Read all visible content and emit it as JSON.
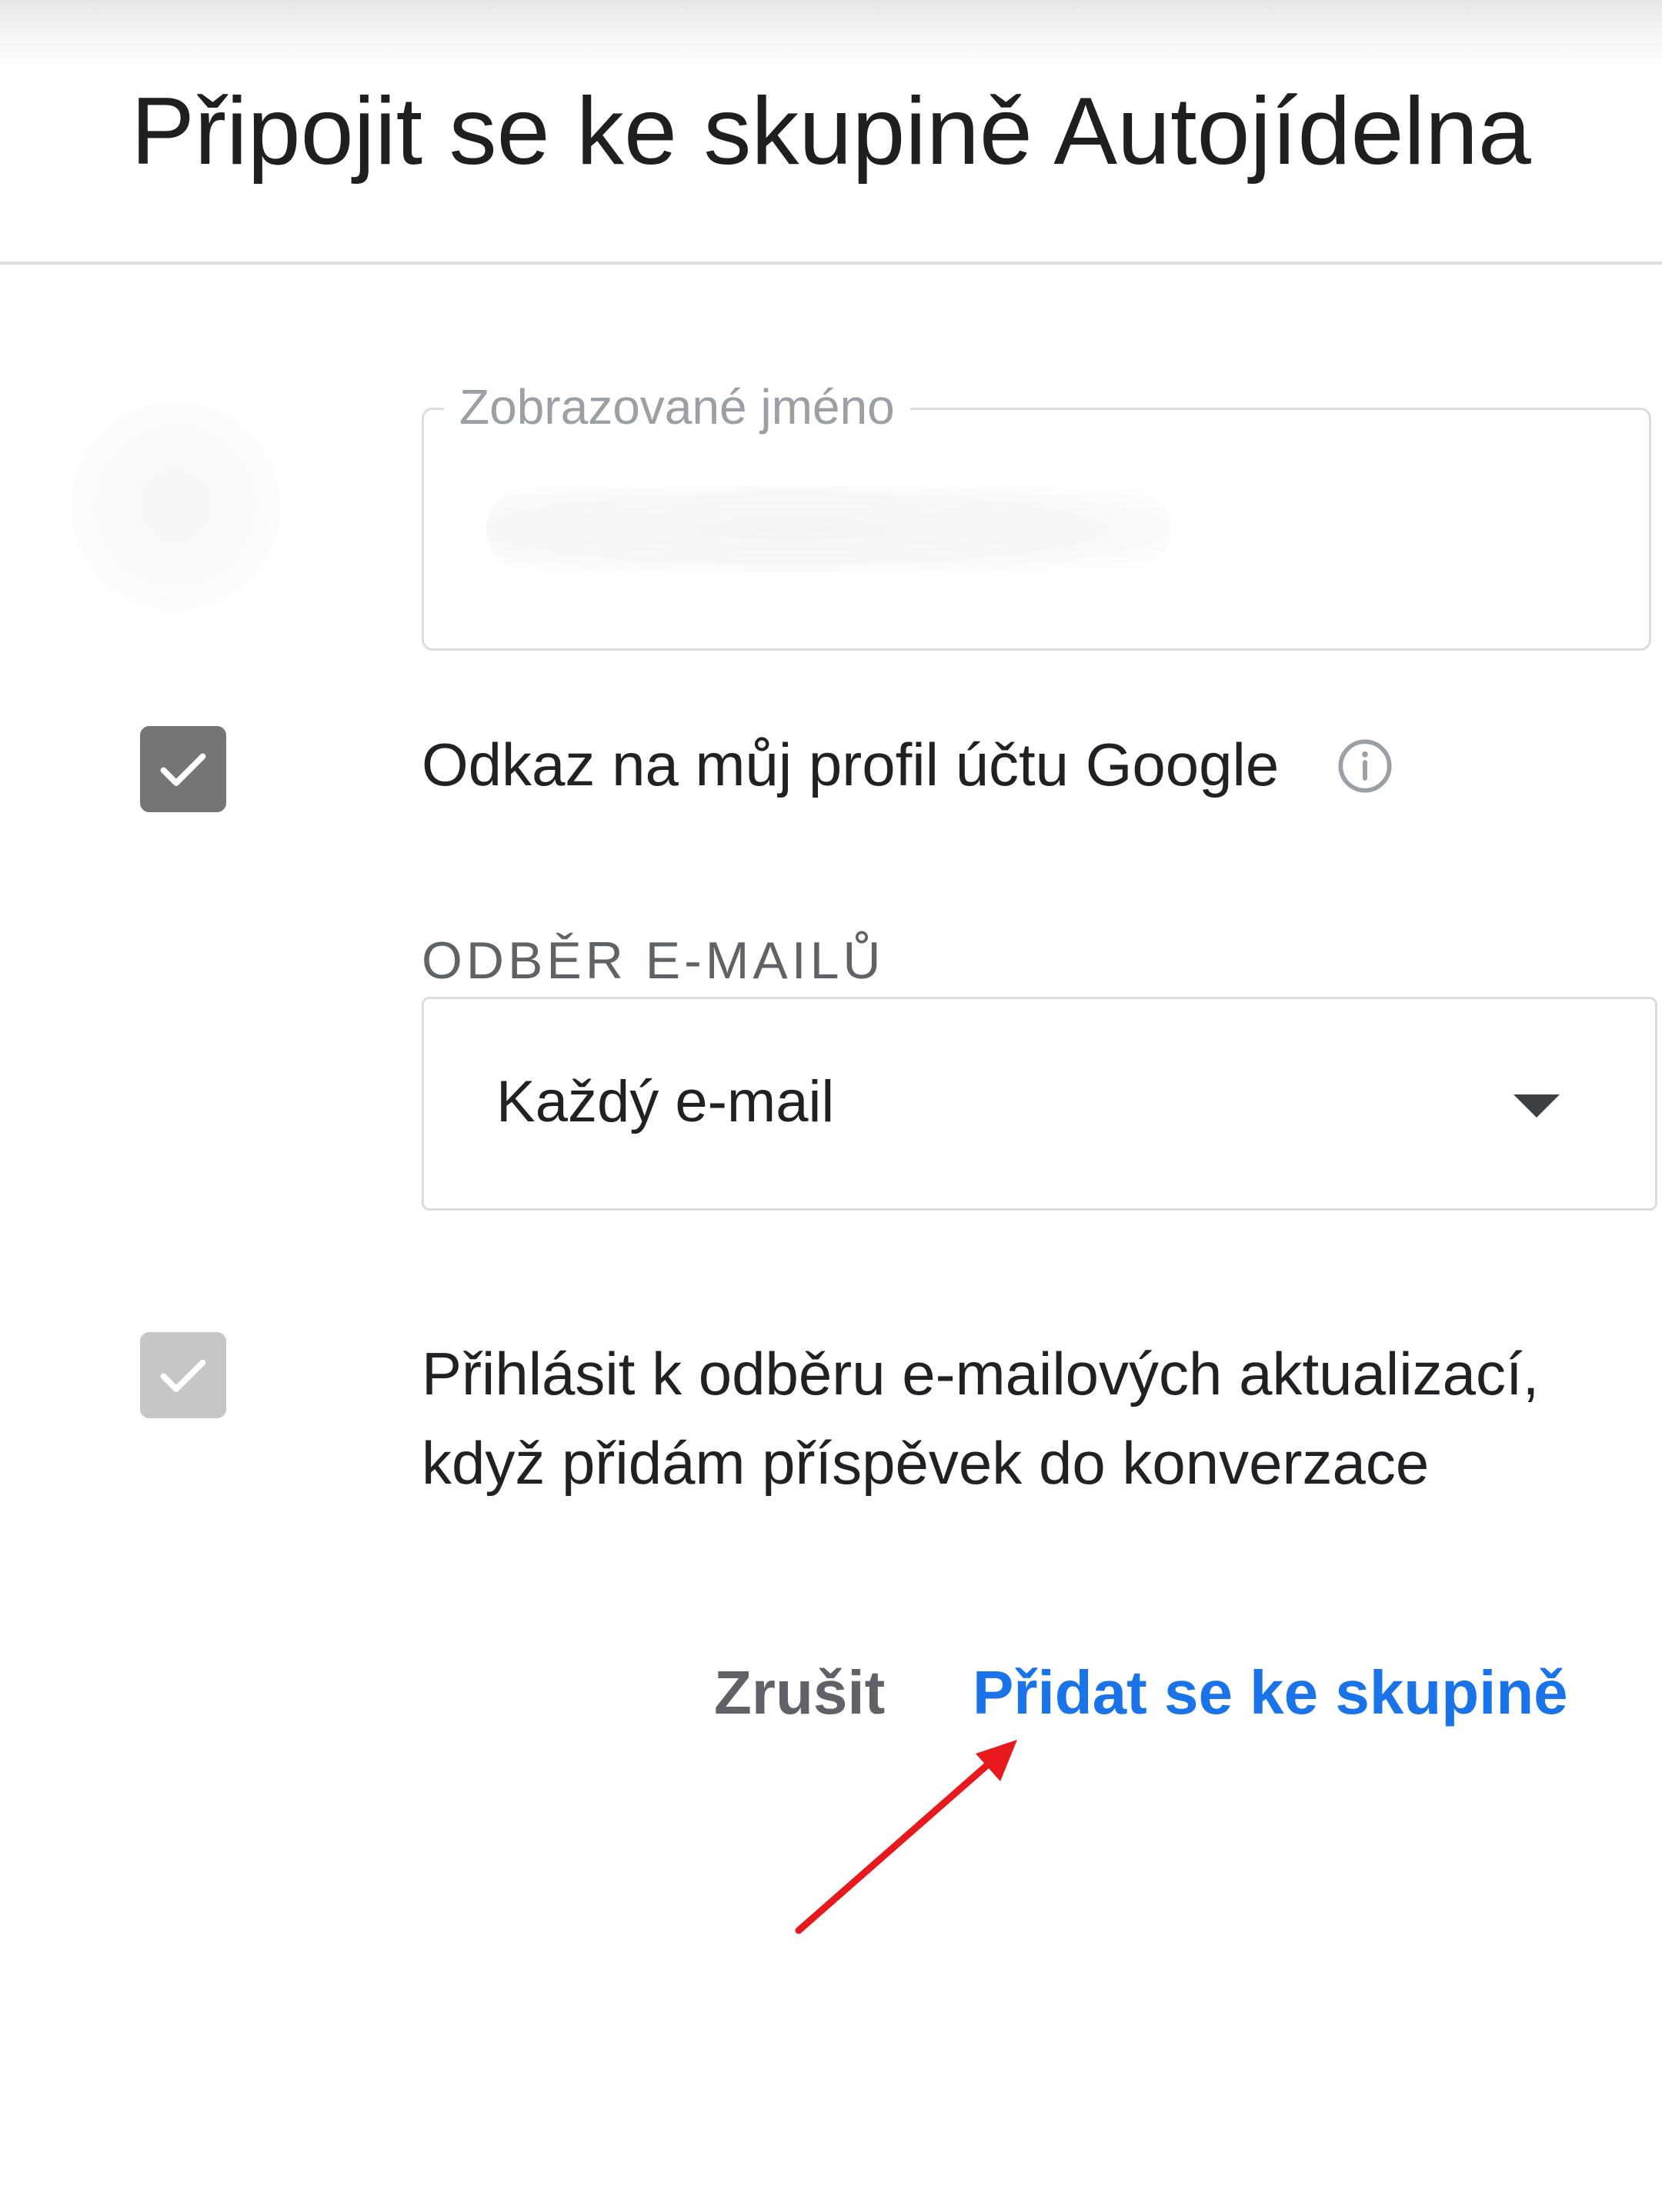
{
  "dialog": {
    "title": "Připojit se ke skupině Autojídelna"
  },
  "display_name": {
    "label": "Zobrazované jméno",
    "value_state": "blurred"
  },
  "profile_link": {
    "label": "Odkaz na můj profil účtu Google",
    "checked": true,
    "icon": "info-icon"
  },
  "email_subscription": {
    "section_label": "ODBĚR E-MAILŮ",
    "selected": "Každý e-mail"
  },
  "subscribe_updates": {
    "label": "Přihlásit k odběru e-mailových aktualizací, když přidám příspěvek do konverzace",
    "checked": true,
    "disabled": true
  },
  "actions": {
    "cancel_label": "Zrušit",
    "join_label": "Přidat se ke skupině"
  },
  "colors": {
    "accent": "#1a73e8",
    "annotation_arrow": "#e8191c"
  }
}
